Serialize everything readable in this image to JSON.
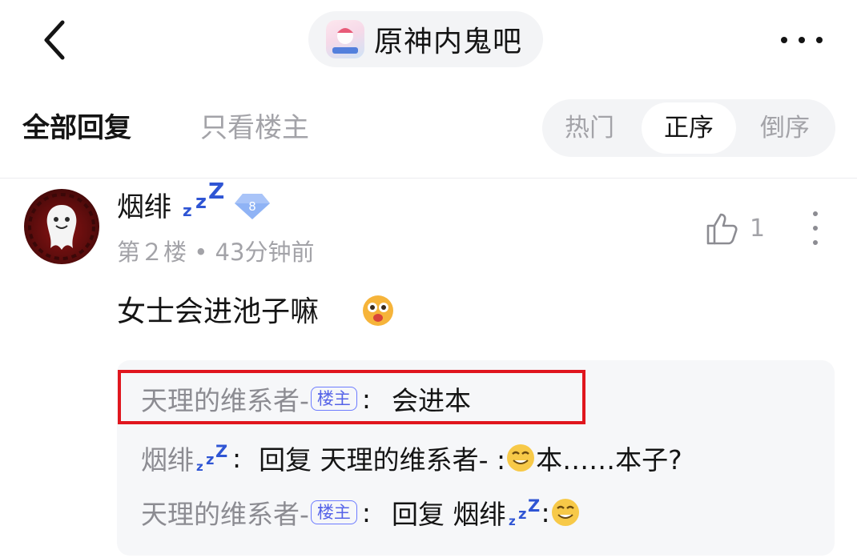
{
  "header": {
    "forum_name": "原神内鬼吧",
    "back_icon": "chevron-left-icon",
    "more_icon": "more-horizontal-icon"
  },
  "tabs": {
    "all_replies": "全部回复",
    "only_op": "只看楼主"
  },
  "sort": {
    "options": [
      "热门",
      "正序",
      "倒序"
    ],
    "active": "正序"
  },
  "post": {
    "username": "烟绯",
    "level": "8",
    "meta": "第２楼 • 43分钟前",
    "likes": "1",
    "content": "女士会进池子嘛"
  },
  "replies": [
    {
      "author": "天理的维系者-",
      "op_tag": "楼主",
      "colon": ":",
      "text": "会进本"
    },
    {
      "author": "烟绯",
      "colon": ":",
      "text_prefix": "回复 天理的维系者- :",
      "text_suffix": "本……本子?"
    },
    {
      "author": "天理的维系者-",
      "op_tag": "楼主",
      "colon": ":",
      "text_prefix": "回复 烟绯",
      "text_suffix": ":"
    }
  ],
  "colors": {
    "accent": "#5563e8",
    "highlight_box": "#e0161e",
    "muted_text": "#a3a3a8",
    "reply_bg": "#f6f7f9"
  }
}
